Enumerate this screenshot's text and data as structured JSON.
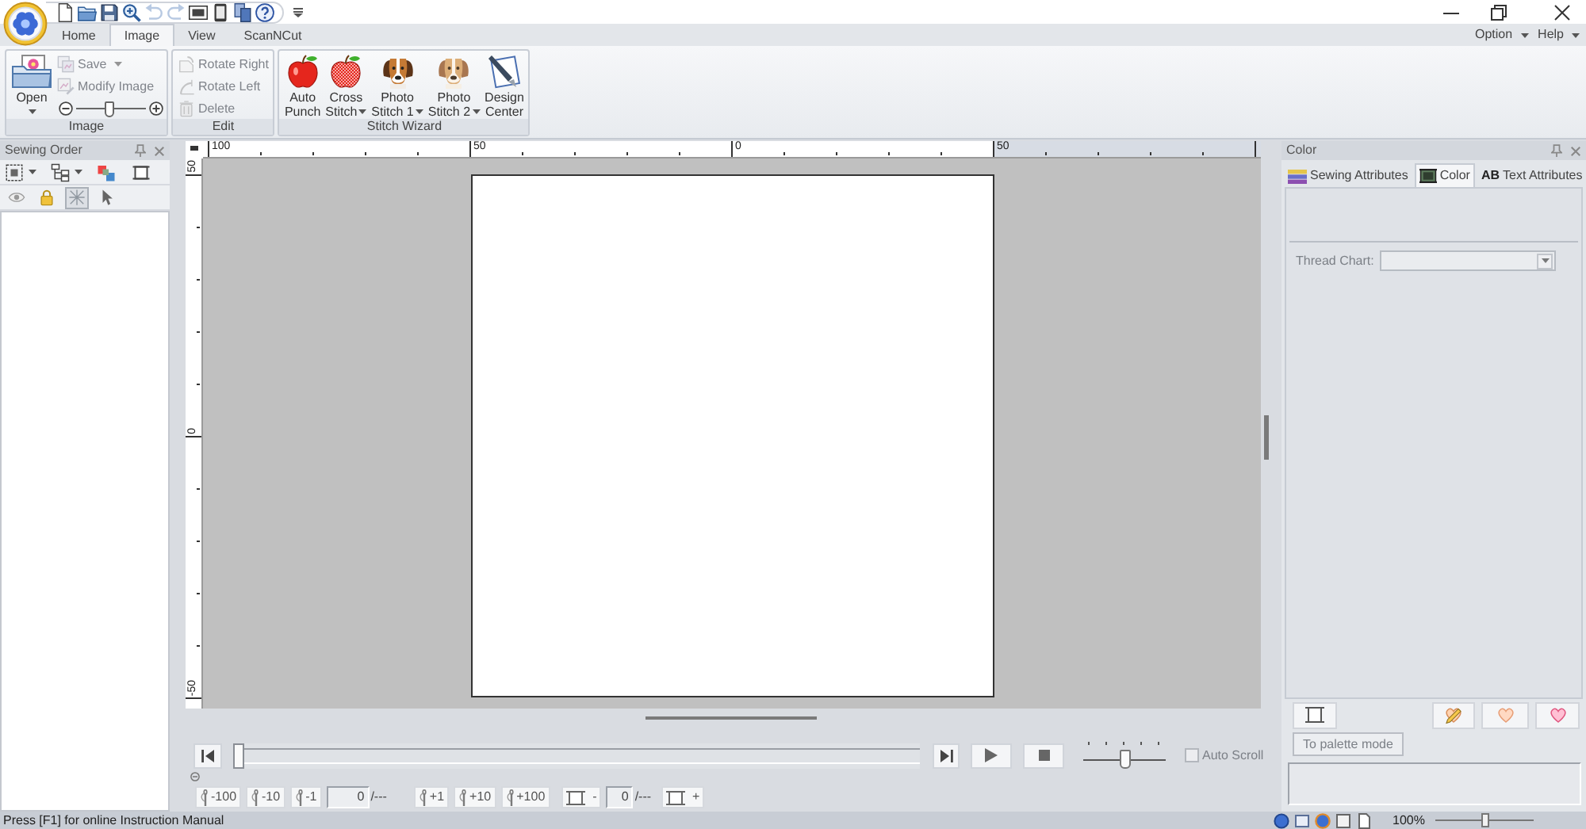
{
  "quick_access": [
    {
      "disabled": false
    },
    {
      "disabled": false
    },
    {
      "disabled": false
    },
    {
      "disabled": false
    },
    {
      "disabled": true
    },
    {
      "disabled": true
    },
    {
      "disabled": false
    },
    {
      "disabled": false
    },
    {
      "disabled": false
    },
    {
      "disabled": false
    }
  ],
  "tabs": [
    {
      "label": "Home",
      "selected": false
    },
    {
      "label": "Image",
      "selected": true
    },
    {
      "label": "View",
      "selected": false
    },
    {
      "label": "ScanNCut",
      "selected": false
    }
  ],
  "menus": [
    {
      "label": "Option"
    },
    {
      "label": "Help"
    }
  ],
  "ribbon_groups": [
    {
      "title": "Image",
      "items": [
        {
          "kind": "large",
          "label_lines": [
            "Open"
          ],
          "dropdown": true,
          "disabled": false
        },
        {
          "kind": "small",
          "label": "Save",
          "dropdown": true,
          "disabled": true
        },
        {
          "kind": "small",
          "label": "Modify Image",
          "dropdown": false,
          "disabled": true
        },
        {
          "kind": "slider",
          "level": 0.48
        }
      ]
    },
    {
      "title": "Edit",
      "items": [
        {
          "kind": "small",
          "label": "Rotate Right",
          "dropdown": false,
          "disabled": true
        },
        {
          "kind": "small",
          "label": "Rotate Left",
          "dropdown": false,
          "disabled": true
        },
        {
          "kind": "small",
          "label": "Delete",
          "dropdown": false,
          "disabled": true
        }
      ]
    },
    {
      "title": "Stitch Wizard",
      "items": [
        {
          "kind": "large",
          "label_lines": [
            "Auto",
            "Punch"
          ],
          "dropdown": false,
          "disabled": false
        },
        {
          "kind": "large",
          "label_lines": [
            "Cross",
            "Stitch"
          ],
          "dropdown": true,
          "disabled": false
        },
        {
          "kind": "large",
          "label_lines": [
            "Photo",
            "Stitch 1"
          ],
          "dropdown": true,
          "disabled": false
        },
        {
          "kind": "large",
          "label_lines": [
            "Photo",
            "Stitch 2"
          ],
          "dropdown": true,
          "disabled": false
        },
        {
          "kind": "large",
          "label_lines": [
            "Design",
            "Center"
          ],
          "dropdown": false,
          "disabled": false
        }
      ]
    }
  ],
  "sewing_order": {
    "title": "Sewing Order",
    "tools": [
      {
        "dropdown": true
      },
      {
        "dropdown": true
      },
      {
        "dropdown": false
      },
      {
        "dropdown": false
      }
    ],
    "view_toggles": [
      {
        "selected": false
      },
      {
        "selected": false
      },
      {
        "selected": true
      },
      {
        "selected": false
      }
    ]
  },
  "rulers": {
    "horizontal": [
      "100",
      "50",
      "0",
      "50"
    ],
    "vertical": [
      "50",
      "0",
      "-50"
    ]
  },
  "playback": {
    "progress": {
      "level": 0
    },
    "speed": {
      "level": 0.5
    },
    "auto_scroll": {
      "label": "Auto Scroll",
      "checked": false,
      "disabled": true
    }
  },
  "stitch_step": {
    "back": [
      "-100",
      "-10",
      "-1"
    ],
    "value": "0",
    "total": "/---",
    "forward": [
      "+1",
      "+10",
      "+100"
    ]
  },
  "frame_step": {
    "back": "-",
    "value": "0",
    "total": "/---",
    "forward": "+"
  },
  "color_panel": {
    "title": "Color",
    "tabs": [
      {
        "label": "Sewing Attributes",
        "selected": false
      },
      {
        "label": "Color",
        "selected": true
      },
      {
        "glyph": "AB",
        "label": "Text Attributes",
        "selected": false
      }
    ],
    "thread_chart": {
      "label": "Thread Chart:",
      "disabled": true
    },
    "palette_button": {
      "label": "To palette mode",
      "disabled": true
    }
  },
  "status_bar": {
    "message": "Press [F1] for online Instruction Manual",
    "zoom": "100%",
    "zoom_slider": {
      "level": 0.5
    }
  }
}
